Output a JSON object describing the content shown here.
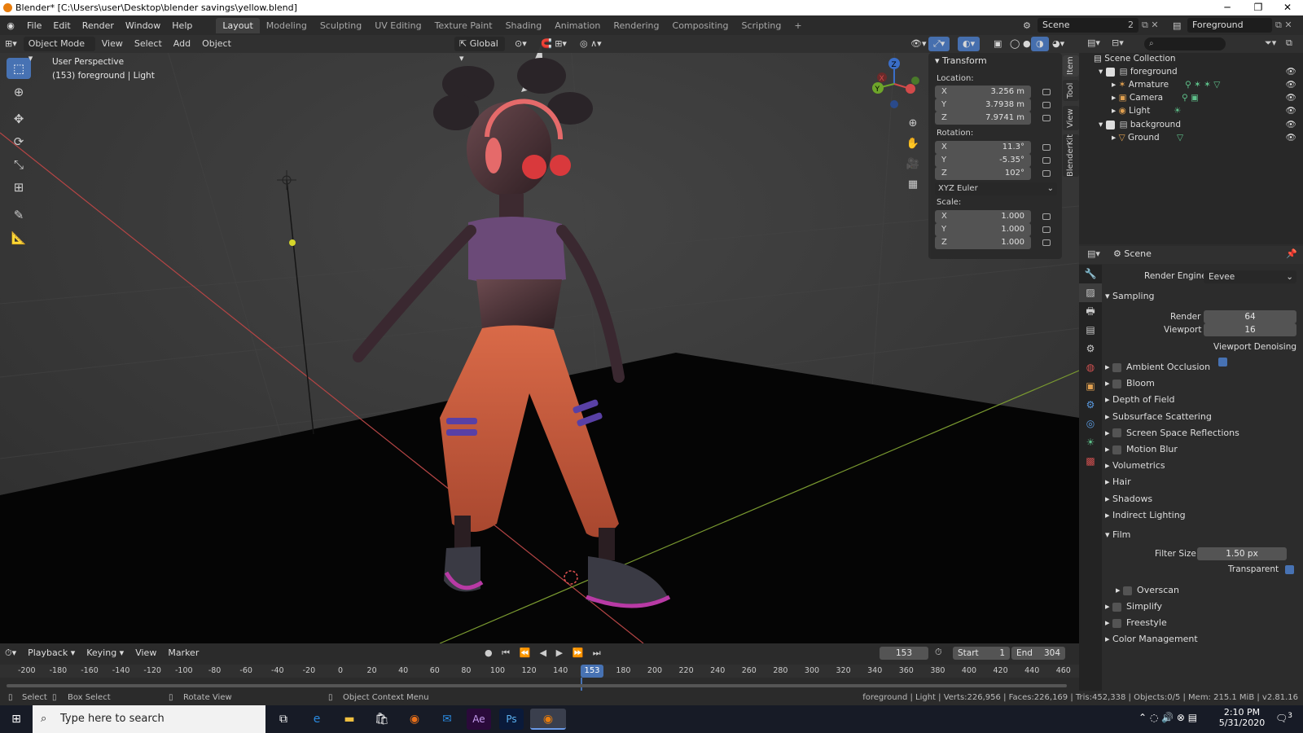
{
  "window": {
    "title": "Blender* [C:\\Users\\user\\Desktop\\blender savings\\yellow.blend]"
  },
  "menus": [
    "File",
    "Edit",
    "Render",
    "Window",
    "Help"
  ],
  "workspaces": [
    "Layout",
    "Modeling",
    "Sculpting",
    "UV Editing",
    "Texture Paint",
    "Shading",
    "Animation",
    "Rendering",
    "Compositing",
    "Scripting"
  ],
  "scene": {
    "label": "Scene",
    "count": "2",
    "view_layer": "Foreground"
  },
  "viewport": {
    "mode": "Object Mode",
    "menus": [
      "View",
      "Select",
      "Add",
      "Object"
    ],
    "orientation": "Global",
    "perspective_label": "User Perspective",
    "object_label": "(153) foreground | Light"
  },
  "sidetabs": [
    "Item",
    "Tool",
    "View",
    "BlenderKit"
  ],
  "transform": {
    "title": "Transform",
    "location_label": "Location:",
    "location": [
      {
        "axis": "X",
        "value": "3.256 m"
      },
      {
        "axis": "Y",
        "value": "3.7938 m"
      },
      {
        "axis": "Z",
        "value": "7.9741 m"
      }
    ],
    "rotation_label": "Rotation:",
    "rotation": [
      {
        "axis": "X",
        "value": "11.3°"
      },
      {
        "axis": "Y",
        "value": "-5.35°"
      },
      {
        "axis": "Z",
        "value": "102°"
      }
    ],
    "rotation_mode": "XYZ Euler",
    "scale_label": "Scale:",
    "scale": [
      {
        "axis": "X",
        "value": "1.000"
      },
      {
        "axis": "Y",
        "value": "1.000"
      },
      {
        "axis": "Z",
        "value": "1.000"
      }
    ]
  },
  "outliner": {
    "root": "Scene Collection",
    "rows": [
      {
        "label": "foreground",
        "kind": "collection"
      },
      {
        "label": "Armature",
        "kind": "armature"
      },
      {
        "label": "Camera",
        "kind": "camera"
      },
      {
        "label": "Light",
        "kind": "light"
      },
      {
        "label": "background",
        "kind": "collection"
      },
      {
        "label": "Ground",
        "kind": "mesh"
      }
    ]
  },
  "properties": {
    "header": "Scene",
    "render_engine_label": "Render Engine",
    "render_engine": "Eevee",
    "sampling": "Sampling",
    "render_label": "Render",
    "render_value": "64",
    "viewport_label": "Viewport",
    "viewport_value": "16",
    "denoise_label": "Viewport Denoising",
    "sections_a": [
      {
        "label": "Ambient Occlusion",
        "check": true
      },
      {
        "label": "Bloom",
        "check": true
      },
      {
        "label": "Depth of Field",
        "check": false
      },
      {
        "label": "Subsurface Scattering",
        "check": false
      },
      {
        "label": "Screen Space Reflections",
        "check": true
      },
      {
        "label": "Motion Blur",
        "check": true
      },
      {
        "label": "Volumetrics",
        "check": false
      },
      {
        "label": "Hair",
        "check": false
      },
      {
        "label": "Shadows",
        "check": false
      },
      {
        "label": "Indirect Lighting",
        "check": false
      }
    ],
    "film": "Film",
    "filter_label": "Filter Size",
    "filter_value": "1.50 px",
    "transparent_label": "Transparent",
    "overscan": "Overscan",
    "sections_b": [
      {
        "label": "Simplify",
        "check": true
      },
      {
        "label": "Freestyle",
        "check": true
      },
      {
        "label": "Color Management",
        "check": false
      }
    ]
  },
  "timeline": {
    "menus": [
      "Playback",
      "Keying",
      "View",
      "Marker"
    ],
    "current_frame": "153",
    "start_label": "Start",
    "start": "1",
    "end_label": "End",
    "end": "304",
    "ticks": [
      "-200",
      "-180",
      "-160",
      "-140",
      "-120",
      "-100",
      "-80",
      "-60",
      "-40",
      "-20",
      "0",
      "20",
      "40",
      "60",
      "80",
      "100",
      "120",
      "140",
      "160",
      "180",
      "200",
      "220",
      "240",
      "260",
      "280",
      "300",
      "320",
      "340",
      "360",
      "380",
      "400",
      "420",
      "440",
      "460"
    ],
    "playhead_label": "153"
  },
  "status": {
    "select": "Select",
    "box_select": "Box Select",
    "rotate": "Rotate View",
    "context": "Object Context Menu",
    "stats": "foreground | Light | Verts:226,956 | Faces:226,169 | Tris:452,338 | Objects:0/5 | Mem: 215.1 MiB | v2.81.16"
  },
  "taskbar": {
    "search_placeholder": "Type here to search",
    "time": "2:10 PM",
    "date": "5/31/2020",
    "notif": "3"
  }
}
